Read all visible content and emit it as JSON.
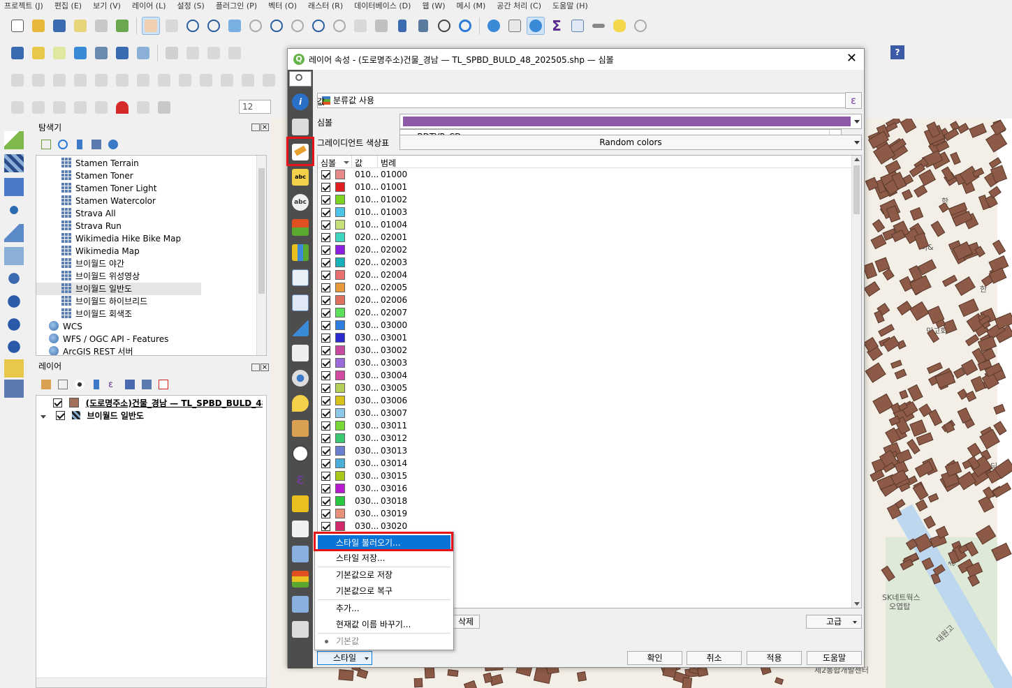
{
  "menubar": [
    "프로젝트 (J)",
    "편집 (E)",
    "보기 (V)",
    "레이어 (L)",
    "설정 (S)",
    "플러그인 (P)",
    "벡터 (O)",
    "래스터 (R)",
    "데이터베이스 (D)",
    "웹 (W)",
    "메시 (M)",
    "공간 처리 (C)",
    "도움말 (H)"
  ],
  "toolbar": {
    "scale_value": "12"
  },
  "browser_panel": {
    "title": "탐색기",
    "items": [
      "Stamen Terrain",
      "Stamen Toner",
      "Stamen Toner Light",
      "Stamen Watercolor",
      "Strava All",
      "Strava Run",
      "Wikimedia Hike Bike Map",
      "Wikimedia Map",
      "브이월드 야간",
      "브이월드 위성영상",
      "브이월드 일반도",
      "브이월드 하이브리드",
      "브이월드 회색조"
    ],
    "groups": [
      "WCS",
      "WFS / OGC API - Features",
      "ArcGIS REST 서버"
    ],
    "selected": "브이월드 일반도"
  },
  "layers_panel": {
    "title": "레이어",
    "layers": [
      {
        "name": "(도로명주소)건물_경남 — TL_SPBD_BULD_48_20",
        "color": "#a0705a"
      },
      {
        "name": "브이월드 일반도"
      }
    ]
  },
  "dialog": {
    "title": "레이어 속성 - (도로명주소)건물_경남 — TL_SPBD_BULD_48_202505.shp — 심볼",
    "renderer": "분류값 사용",
    "value_label": "값",
    "value_field": "BDTYP_CD",
    "value_prefix": "abc",
    "symbol_label": "심볼",
    "symbol_color": "#8e5aa8",
    "gradient_label": "그레이디언트 색상표",
    "gradient_value": "Random colors",
    "col_symbol": "심볼",
    "col_value": "값",
    "col_legend": "범례",
    "rows": [
      {
        "value": "010...",
        "legend": "01000",
        "color": "#e88a8a"
      },
      {
        "value": "010...",
        "legend": "01001",
        "color": "#e02020"
      },
      {
        "value": "010...",
        "legend": "01002",
        "color": "#7ed321"
      },
      {
        "value": "010...",
        "legend": "01003",
        "color": "#4ec3e8"
      },
      {
        "value": "010...",
        "legend": "01004",
        "color": "#c6e07a"
      },
      {
        "value": "020...",
        "legend": "02001",
        "color": "#3fd6c0"
      },
      {
        "value": "020...",
        "legend": "02002",
        "color": "#8a1fe0"
      },
      {
        "value": "020...",
        "legend": "02003",
        "color": "#16b0b8"
      },
      {
        "value": "020...",
        "legend": "02004",
        "color": "#e87070"
      },
      {
        "value": "020...",
        "legend": "02005",
        "color": "#e89a3a"
      },
      {
        "value": "020...",
        "legend": "02006",
        "color": "#e07060"
      },
      {
        "value": "020...",
        "legend": "02007",
        "color": "#5ae05a"
      },
      {
        "value": "030...",
        "legend": "03000",
        "color": "#2e7ee0"
      },
      {
        "value": "030...",
        "legend": "03001",
        "color": "#2a2ad0"
      },
      {
        "value": "030...",
        "legend": "03002",
        "color": "#c84a9e"
      },
      {
        "value": "030...",
        "legend": "03003",
        "color": "#9a6ad8"
      },
      {
        "value": "030...",
        "legend": "03004",
        "color": "#d04aa0"
      },
      {
        "value": "030...",
        "legend": "03005",
        "color": "#b4d05a"
      },
      {
        "value": "030...",
        "legend": "03006",
        "color": "#d8c21a"
      },
      {
        "value": "030...",
        "legend": "03007",
        "color": "#8ec8e8"
      },
      {
        "value": "030...",
        "legend": "03011",
        "color": "#78d83a"
      },
      {
        "value": "030...",
        "legend": "03012",
        "color": "#3ac870"
      },
      {
        "value": "030...",
        "legend": "03013",
        "color": "#6a7ed0"
      },
      {
        "value": "030...",
        "legend": "03014",
        "color": "#4aaed8"
      },
      {
        "value": "030...",
        "legend": "03015",
        "color": "#a8c81a"
      },
      {
        "value": "030...",
        "legend": "03016",
        "color": "#b81ad0"
      },
      {
        "value": "030...",
        "legend": "03018",
        "color": "#2ac840"
      },
      {
        "value": "030...",
        "legend": "03019",
        "color": "#e8907a"
      },
      {
        "value": "030...",
        "legend": "03020",
        "color": "#d02a6a"
      }
    ],
    "delete_button": "삭제",
    "advanced_button": "고급",
    "style_button": "스타일",
    "ok_button": "확인",
    "cancel_button": "취소",
    "apply_button": "적용",
    "help_button": "도움말"
  },
  "style_menu": {
    "items": [
      "스타일 불러오기...",
      "스타일 저장...",
      "기본값으로 저장",
      "기본값으로 복구",
      "추가...",
      "현재값 이름 바꾸기...",
      "기본값"
    ],
    "highlighted": "스타일 불러오기..."
  },
  "map_labels": [
    "한",
    "히&",
    "한",
    "민고회",
    "모",
    "은딩",
    "SK네트웍스",
    "오엽탑",
    "대원고",
    "청리대",
    "제2통합개발센터"
  ],
  "accent": "#0a74d6",
  "highlight_red": "#e8121a"
}
